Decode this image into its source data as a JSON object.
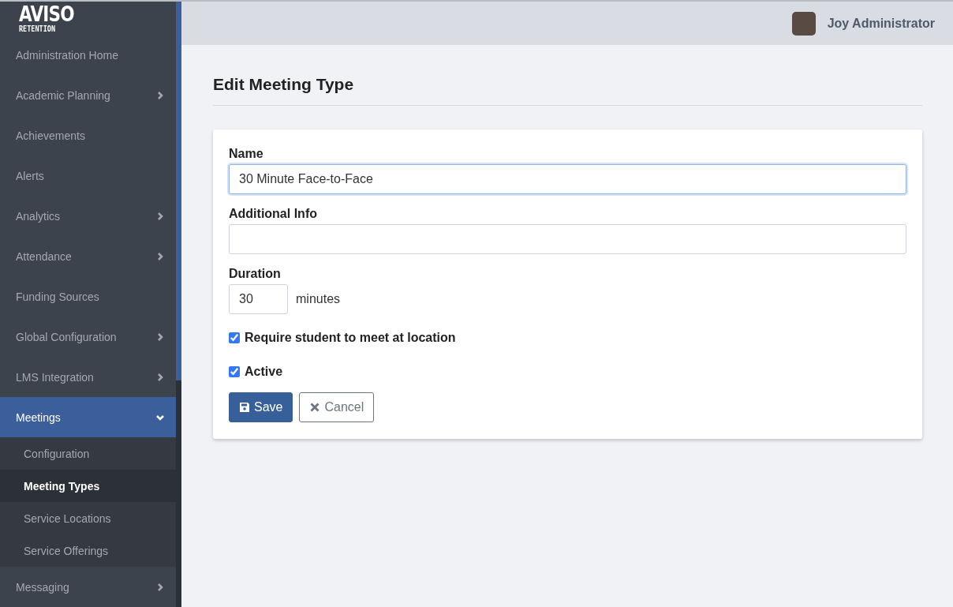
{
  "logo": {
    "title": "AVISO",
    "subtitle": "RETENTION"
  },
  "user": {
    "name": "Joy Administrator"
  },
  "sidebar": {
    "items": [
      {
        "label": "Administration Home",
        "kind": "link",
        "selected": false
      },
      {
        "label": "Academic Planning",
        "kind": "group",
        "expanded": false,
        "selected": false
      },
      {
        "label": "Achievements",
        "kind": "link",
        "selected": false
      },
      {
        "label": "Alerts",
        "kind": "link",
        "selected": false
      },
      {
        "label": "Analytics",
        "kind": "group",
        "expanded": false,
        "selected": false
      },
      {
        "label": "Attendance",
        "kind": "group",
        "expanded": false,
        "selected": false
      },
      {
        "label": "Funding Sources",
        "kind": "link",
        "selected": false
      },
      {
        "label": "Global Configuration",
        "kind": "group",
        "expanded": false,
        "selected": false
      },
      {
        "label": "LMS Integration",
        "kind": "group",
        "expanded": false,
        "selected": false
      },
      {
        "label": "Meetings",
        "kind": "group",
        "expanded": true,
        "selected": true,
        "children": [
          {
            "label": "Configuration",
            "selected": false
          },
          {
            "label": "Meeting Types",
            "selected": true
          },
          {
            "label": "Service Locations",
            "selected": false
          },
          {
            "label": "Service Offerings",
            "selected": false
          }
        ]
      },
      {
        "label": "Messaging",
        "kind": "group",
        "expanded": false,
        "selected": false
      }
    ]
  },
  "page": {
    "title": "Edit Meeting Type"
  },
  "form": {
    "name": {
      "label": "Name",
      "value": "30 Minute Face-to-Face",
      "focused": true
    },
    "additional_info": {
      "label": "Additional Info",
      "focused": false
    },
    "duration": {
      "label": "Duration",
      "value": "30",
      "unit": "minutes"
    },
    "checkboxes": [
      {
        "label": "Require student to meet at location",
        "checked": true
      },
      {
        "label": "Active",
        "checked": true
      }
    ],
    "buttons": [
      {
        "label": "Save",
        "kind": "primary"
      },
      {
        "label": "Cancel",
        "kind": "secondary"
      }
    ]
  }
}
